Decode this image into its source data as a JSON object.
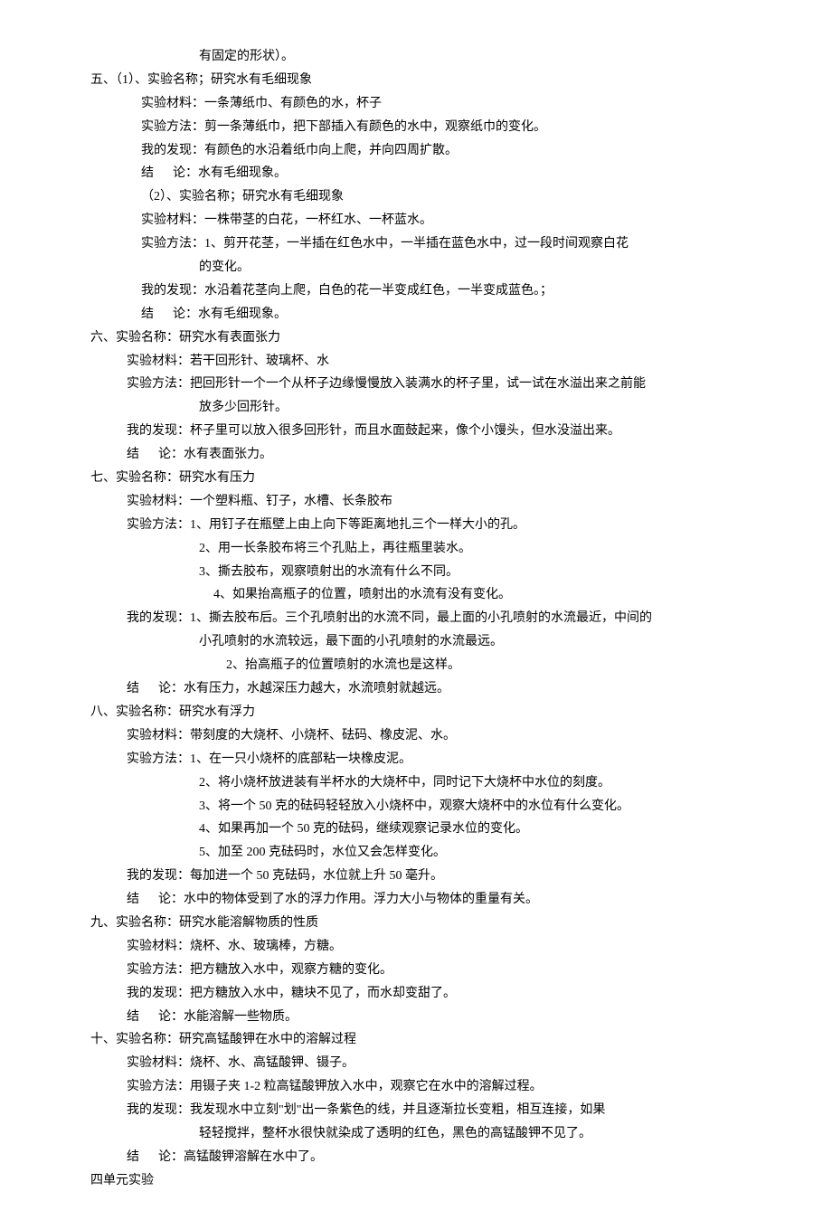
{
  "lines": [
    {
      "cls": "indent-3",
      "text": "有固定的形状）。"
    },
    {
      "cls": "section-title",
      "text": "五、（1）、实验名称；研究水有毛细现象"
    },
    {
      "cls": "indent-2",
      "text": "实验材料：一条薄纸巾、有颜色的水，杯子"
    },
    {
      "cls": "indent-2",
      "text": "实验方法：剪一条薄纸巾，把下部插入有颜色的水中，观察纸巾的变化。"
    },
    {
      "cls": "indent-2",
      "text": "我的发现：有颜色的水沿着纸巾向上爬，并向四周扩散。"
    },
    {
      "cls": "indent-2",
      "text": "结      论：水有毛细现象。"
    },
    {
      "cls": "indent-2",
      "text": "（2）、实验名称；研究水有毛细现象"
    },
    {
      "cls": "indent-2",
      "text": "实验材料：一株带茎的白花，一杯红水、一杯蓝水。"
    },
    {
      "cls": "indent-2",
      "text": "实验方法：1、剪开花茎，一半插在红色水中，一半插在蓝色水中，过一段时间观察白花"
    },
    {
      "cls": "indent-3",
      "text": "的变化。"
    },
    {
      "cls": "indent-2",
      "text": "我的发现：水沿着花茎向上爬，白色的花一半变成红色，一半变成蓝色。；"
    },
    {
      "cls": "indent-2",
      "text": "结      论：水有毛细现象。"
    },
    {
      "cls": "section-title",
      "text": "六、实验名称：研究水有表面张力"
    },
    {
      "cls": "indent-1",
      "text": "实验材料：若干回形针、玻璃杯、水"
    },
    {
      "cls": "indent-1",
      "text": "实验方法：把回形针一个一个从杯子边缘慢慢放入装满水的杯子里，试一试在水溢出来之前能"
    },
    {
      "cls": "indent-3",
      "text": "放多少回形针。"
    },
    {
      "cls": "indent-1",
      "text": "我的发现：杯子里可以放入很多回形针，而且水面鼓起来，像个小馒头，但水没溢出来。"
    },
    {
      "cls": "indent-1",
      "text": "结      论：水有表面张力。"
    },
    {
      "cls": "section-title",
      "text": "七、实验名称：研究水有压力"
    },
    {
      "cls": "indent-1",
      "text": "实验材料：一个塑料瓶、钉子，水槽、长条胶布"
    },
    {
      "cls": "indent-1",
      "text": "实验方法：1、用钉子在瓶壁上由上向下等距离地扎三个一样大小的孔。"
    },
    {
      "cls": "indent-3",
      "text": "2、用一长条胶布将三个孔贴上，再往瓶里装水。"
    },
    {
      "cls": "indent-3",
      "text": "3、撕去胶布，观察喷射出的水流有什么不同。"
    },
    {
      "cls": "indent-4",
      "text": "4、如果抬高瓶子的位置，喷射出的水流有没有变化。"
    },
    {
      "cls": "indent-1",
      "text": "我的发现：1、撕去胶布后。三个孔喷射出的水流不同，最上面的小孔喷射的水流最近，中间的"
    },
    {
      "cls": "indent-3",
      "text": "小孔喷射的水流较远，最下面的小孔喷射的水流最远。"
    },
    {
      "cls": "indent-5",
      "text": "2、抬高瓶子的位置喷射的水流也是这样。"
    },
    {
      "cls": "indent-1",
      "text": "结      论：水有压力，水越深压力越大，水流喷射就越远。"
    },
    {
      "cls": "section-title",
      "text": "八、实验名称：研究水有浮力"
    },
    {
      "cls": "indent-1",
      "text": "实验材料：带刻度的大烧杯、小烧杯、砝码、橡皮泥、水。"
    },
    {
      "cls": "indent-1",
      "text": "实验方法：1、在一只小烧杯的底部粘一块橡皮泥。"
    },
    {
      "cls": "indent-3",
      "text": "2、将小烧杯放进装有半杯水的大烧杯中，同时记下大烧杯中水位的刻度。"
    },
    {
      "cls": "indent-3",
      "text": "3、将一个 50 克的砝码轻轻放入小烧杯中，观察大烧杯中的水位有什么变化。"
    },
    {
      "cls": "indent-3",
      "text": "4、如果再加一个 50 克的砝码，继续观察记录水位的变化。"
    },
    {
      "cls": "indent-3",
      "text": "5、加至 200 克砝码时，水位又会怎样变化。"
    },
    {
      "cls": "indent-1",
      "text": "我的发现：每加进一个 50 克砝码，水位就上升 50 毫升。"
    },
    {
      "cls": "indent-1",
      "text": "结      论：水中的物体受到了水的浮力作用。浮力大小与物体的重量有关。"
    },
    {
      "cls": "section-title",
      "text": "九、实验名称：研究水能溶解物质的性质"
    },
    {
      "cls": "indent-1",
      "text": "实验材料：烧杯、水、玻璃棒，方糖。"
    },
    {
      "cls": "indent-1",
      "text": "实验方法：把方糖放入水中，观察方糖的变化。"
    },
    {
      "cls": "indent-1",
      "text": "我的发现：把方糖放入水中，糖块不见了，而水却变甜了。"
    },
    {
      "cls": "indent-1",
      "text": "结      论：水能溶解一些物质。"
    },
    {
      "cls": "section-title",
      "text": "十、实验名称：研究高锰酸钾在水中的溶解过程"
    },
    {
      "cls": "indent-1",
      "text": "实验材料：烧杯、水、高锰酸钾、镊子。"
    },
    {
      "cls": "indent-1",
      "text": "实验方法：用镊子夹 1-2 粒高锰酸钾放入水中，观察它在水中的溶解过程。"
    },
    {
      "cls": "indent-1",
      "text": "我的发现：我发现水中立刻\"划\"出一条紫色的线，并且逐渐拉长变粗，相互连接，如果"
    },
    {
      "cls": "indent-3",
      "text": "轻轻搅拌，整杯水很快就染成了透明的红色，黑色的高锰酸钾不见了。"
    },
    {
      "cls": "indent-1",
      "text": "结      论：高锰酸钾溶解在水中了。"
    },
    {
      "cls": "footer",
      "text": "四单元实验"
    }
  ]
}
